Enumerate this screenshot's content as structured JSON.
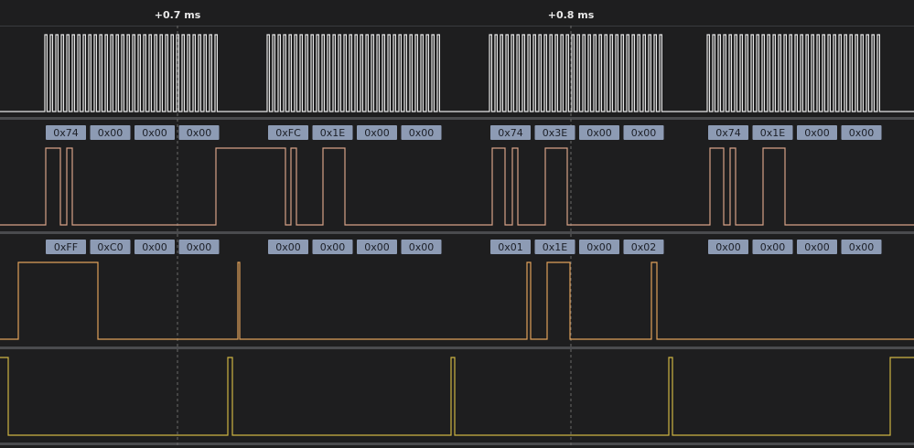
{
  "time_markers": [
    {
      "label": "+0.7 ms"
    },
    {
      "label": "+0.8 ms"
    }
  ],
  "colors": {
    "background": "#1e1e1f",
    "separator": "#4a4b4e",
    "marker_line": "#6a6a6a",
    "clock": "#e6e6e6",
    "mosi": "#d7a287",
    "miso": "#e0a15a",
    "enable": "#cdb443",
    "label_bg": "#8d9bb4",
    "label_text": "#1c1f27"
  },
  "channels": [
    {
      "id": "clock",
      "color_key": "clock"
    },
    {
      "id": "mosi",
      "color_key": "mosi"
    },
    {
      "id": "miso",
      "color_key": "miso"
    },
    {
      "id": "enable",
      "color_key": "enable"
    }
  ],
  "decoded": {
    "mosi": [
      [
        "0x74",
        "0x00",
        "0x00",
        "0x00"
      ],
      [
        "0xFC",
        "0x1E",
        "0x00",
        "0x00"
      ],
      [
        "0x74",
        "0x3E",
        "0x00",
        "0x00"
      ],
      [
        "0x74",
        "0x1E",
        "0x00",
        "0x00"
      ]
    ],
    "miso": [
      [
        "0xFF",
        "0xC0",
        "0x00",
        "0x00"
      ],
      [
        "0x00",
        "0x00",
        "0x00",
        "0x00"
      ],
      [
        "0x01",
        "0x1E",
        "0x00",
        "0x02"
      ],
      [
        "0x00",
        "0x00",
        "0x00",
        "0x00"
      ]
    ]
  }
}
